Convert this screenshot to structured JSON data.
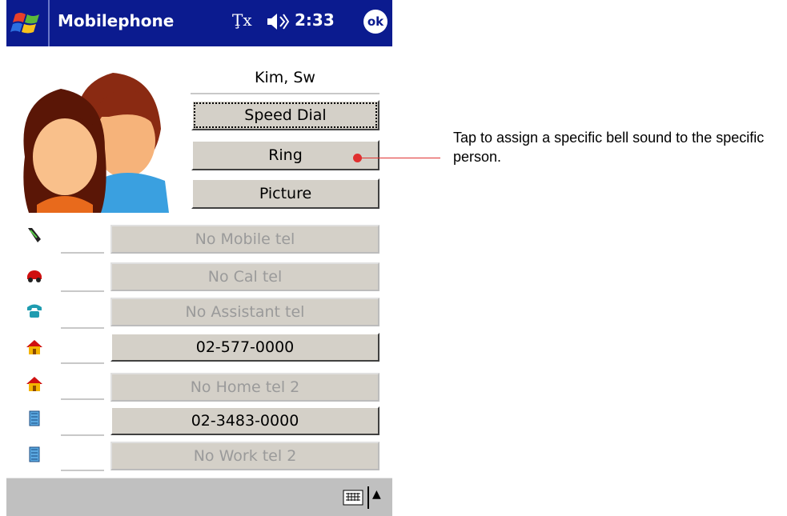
{
  "titlebar": {
    "app_title": "Mobilephone",
    "signal_text": "Ţx",
    "time": "2:33",
    "ok_label": "ok",
    "color": "#0b1b8f"
  },
  "contact": {
    "name": "Kim, Sw",
    "buttons": {
      "speed_dial": "Speed Dial",
      "ring": "Ring",
      "picture": "Picture"
    }
  },
  "phones": [
    {
      "icon": "mobile-phone-icon",
      "value": "No Mobile tel",
      "enabled": false
    },
    {
      "icon": "car-icon",
      "value": "No Cal tel",
      "enabled": false
    },
    {
      "icon": "assistant-phone-icon",
      "value": "No Assistant tel",
      "enabled": false
    },
    {
      "icon": "home-icon",
      "value": "02-577-0000",
      "enabled": true
    },
    {
      "icon": "home-icon",
      "value": "No Home tel 2",
      "enabled": false
    },
    {
      "icon": "work-building-icon",
      "value": "02-3483-0000",
      "enabled": true
    },
    {
      "icon": "work-building-icon",
      "value": "No Work tel 2",
      "enabled": false
    }
  ],
  "bottombar": {
    "keyboard_icon": "keyboard-icon",
    "arrow": "▲"
  },
  "annotation": {
    "text": "Tap to assign a specific bell sound to the specific person.",
    "color": "#e03030"
  }
}
